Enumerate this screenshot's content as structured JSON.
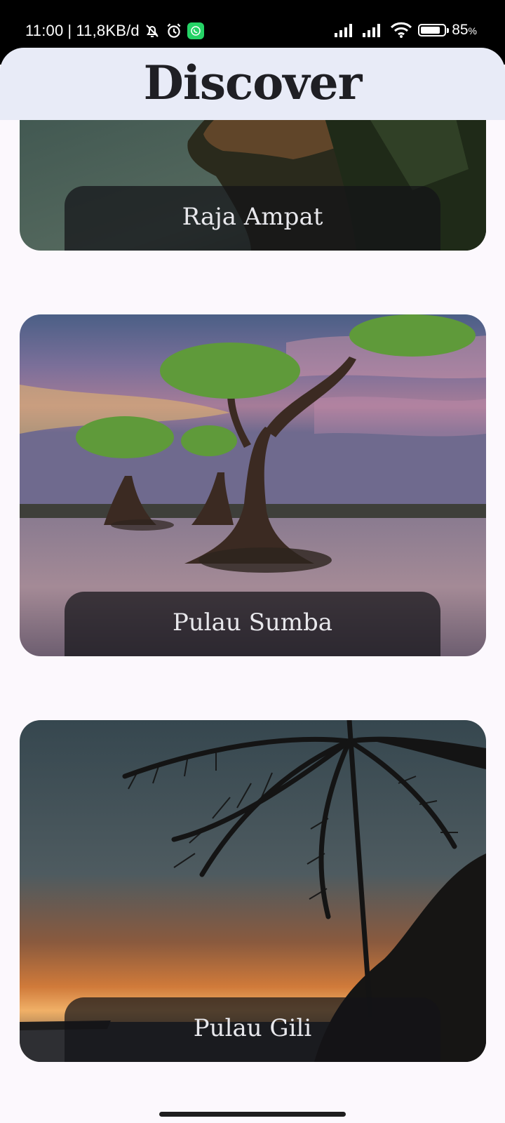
{
  "status_bar": {
    "time": "11:00",
    "network_speed": "11,8KB/d",
    "battery_percent": "85",
    "battery_level": 0.85,
    "icons": [
      "bell-off-icon",
      "alarm-icon",
      "whatsapp-icon",
      "signal-icon",
      "signal-icon",
      "wifi-icon",
      "battery-icon"
    ]
  },
  "header": {
    "title": "Discover"
  },
  "destinations": [
    {
      "name": "Raja Ampat"
    },
    {
      "name": "Pulau Sumba"
    },
    {
      "name": "Pulau Gili"
    }
  ],
  "colors": {
    "header_bg": "#e8ebf7",
    "page_bg": "#fcf8fd",
    "caption_bg": "#141418"
  }
}
